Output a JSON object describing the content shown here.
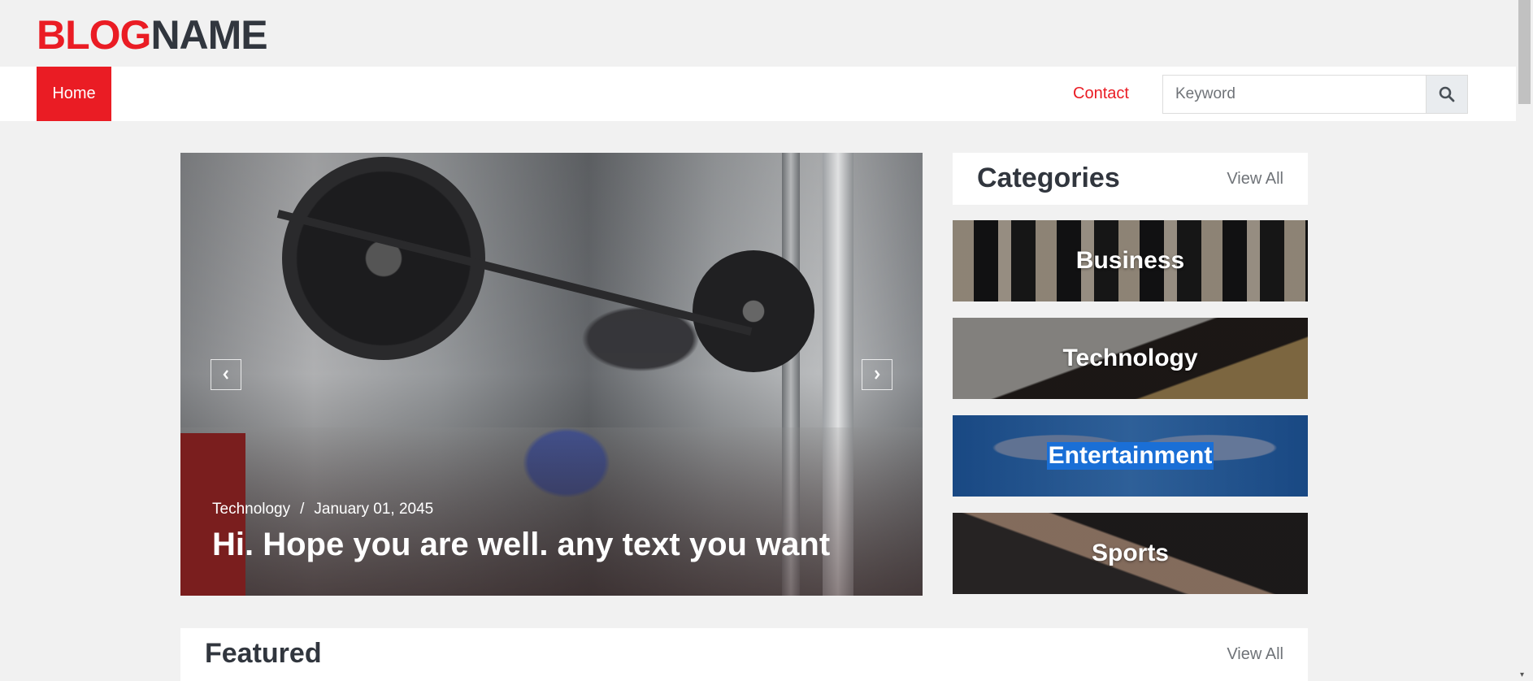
{
  "logo": {
    "part1": "BLOG",
    "part2": "NAME"
  },
  "nav": {
    "home": "Home",
    "contact": "Contact"
  },
  "search": {
    "placeholder": "Keyword",
    "icon": "search-icon"
  },
  "hero": {
    "category": "Technology",
    "separator": "/",
    "date": "January 01, 2045",
    "title": "Hi. Hope you are well. any text you want"
  },
  "categories": {
    "title": "Categories",
    "view_all": "View All",
    "items": [
      {
        "label": "Business"
      },
      {
        "label": "Technology"
      },
      {
        "label": "Entertainment"
      },
      {
        "label": "Sports"
      }
    ]
  },
  "featured": {
    "title": "Featured",
    "view_all": "View All"
  },
  "colors": {
    "accent": "#ea1c24",
    "dark": "#31363e",
    "highlight": "#1a6fd6"
  }
}
